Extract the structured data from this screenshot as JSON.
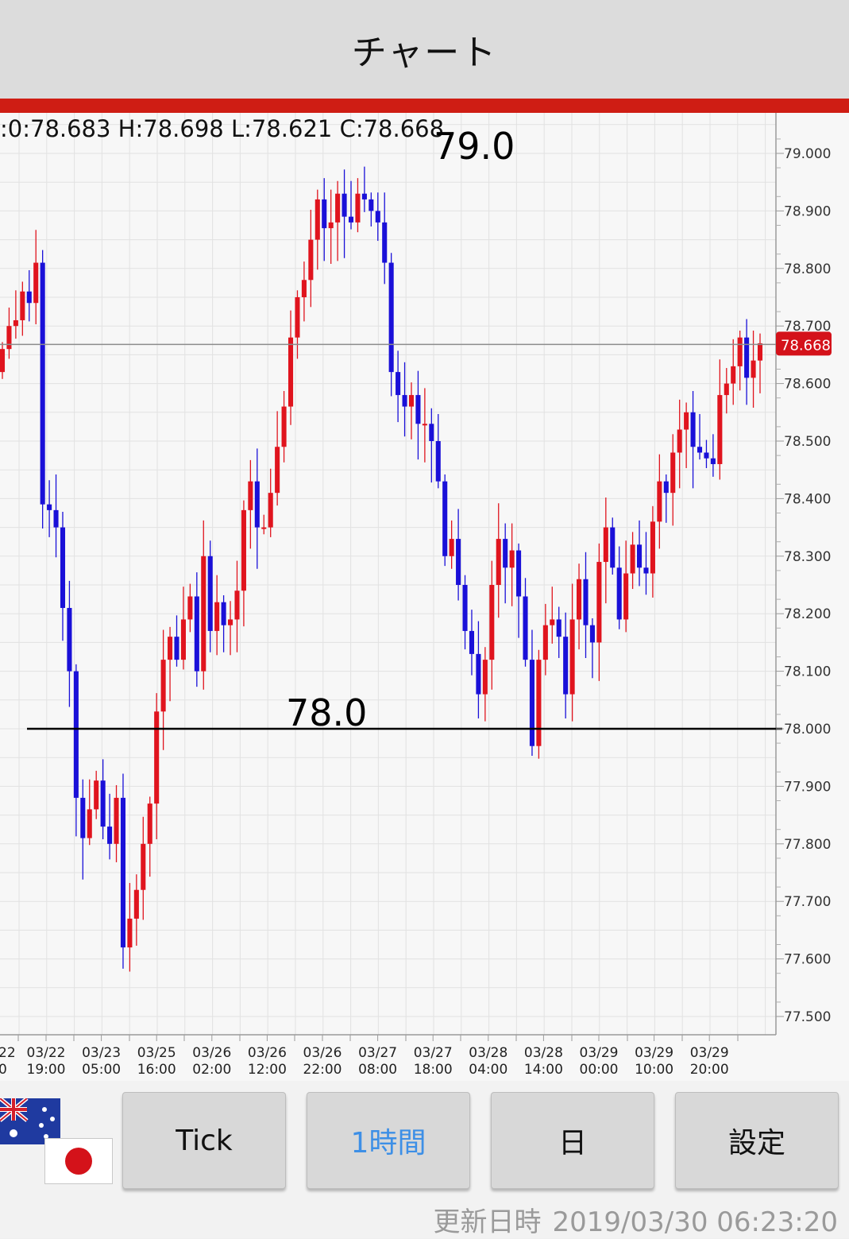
{
  "header": {
    "title": "チャート"
  },
  "chart": {
    "ohlc_text": ":0:78.683 H:78.698 L:78.621 C:78.668",
    "current_price_label": "78.668",
    "reference_labels": {
      "upper": "79.0",
      "lower": "78.0"
    },
    "x_edge_label": {
      "date": "22",
      "time": "0"
    }
  },
  "chart_data": {
    "type": "candlestick",
    "title": "",
    "ylim": [
      77.45,
      79.07
    ],
    "y_ticks": [
      "79.000",
      "78.900",
      "78.800",
      "78.700",
      "78.600",
      "78.500",
      "78.400",
      "78.300",
      "78.200",
      "78.100",
      "78.000",
      "77.900",
      "77.800",
      "77.700",
      "77.600",
      "77.500"
    ],
    "x_tick_labels": [
      {
        "date": "03/22",
        "time": "19:00"
      },
      {
        "date": "03/23",
        "time": "05:00"
      },
      {
        "date": "03/25",
        "time": "16:00"
      },
      {
        "date": "03/26",
        "time": "02:00"
      },
      {
        "date": "03/26",
        "time": "12:00"
      },
      {
        "date": "03/26",
        "time": "22:00"
      },
      {
        "date": "03/27",
        "time": "08:00"
      },
      {
        "date": "03/27",
        "time": "18:00"
      },
      {
        "date": "03/28",
        "time": "04:00"
      },
      {
        "date": "03/28",
        "time": "14:00"
      },
      {
        "date": "03/29",
        "time": "00:00"
      },
      {
        "date": "03/29",
        "time": "10:00"
      },
      {
        "date": "03/29",
        "time": "20:00"
      }
    ],
    "horizontal_lines": [
      78.0,
      78.668
    ],
    "colors": {
      "up": "#e0141e",
      "down": "#1a10d8",
      "last_price_tag": "#d4121a"
    },
    "candles_close": [
      78.66,
      78.7,
      78.71,
      78.76,
      78.74,
      78.81,
      78.39,
      78.38,
      78.35,
      78.21,
      78.1,
      77.88,
      77.81,
      77.86,
      77.91,
      77.83,
      77.8,
      77.88,
      77.62,
      77.67,
      77.72,
      77.8,
      77.87,
      78.03,
      78.12,
      78.16,
      78.12,
      78.19,
      78.23,
      78.1,
      78.3,
      78.17,
      78.22,
      78.18,
      78.19,
      78.24,
      78.38,
      78.43,
      78.35,
      78.35,
      78.41,
      78.49,
      78.56,
      78.68,
      78.75,
      78.78,
      78.85,
      78.92,
      78.87,
      78.88,
      78.93,
      78.89,
      78.88,
      78.93,
      78.92,
      78.9,
      78.88,
      78.81,
      78.62,
      78.58,
      78.56,
      78.58,
      78.53,
      78.53,
      78.5,
      78.43,
      78.3,
      78.33,
      78.25,
      78.17,
      78.13,
      78.06,
      78.12,
      78.25,
      78.33,
      78.28,
      78.31,
      78.23,
      78.12,
      77.97,
      78.12,
      78.18,
      78.19,
      78.16,
      78.06,
      78.19,
      78.26,
      78.18,
      78.15,
      78.29,
      78.35,
      78.28,
      78.19,
      78.27,
      78.32,
      78.28,
      78.27,
      78.36,
      78.43,
      78.41,
      78.48,
      78.52,
      78.55,
      78.49,
      78.48,
      78.47,
      78.46,
      78.58,
      78.6,
      78.63,
      78.68,
      78.61,
      78.64,
      78.67
    ]
  },
  "toolbar": {
    "tick": "Tick",
    "hour": "1時間",
    "day": "日",
    "settings": "設定"
  },
  "footer": {
    "updated_label": "更新日時",
    "updated_value": "2019/03/30 06:23:20"
  }
}
